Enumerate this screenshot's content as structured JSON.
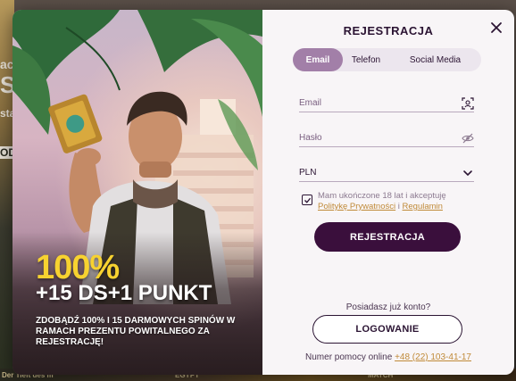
{
  "background": {
    "left_text_1": "ac",
    "left_text_2": "S",
    "left_text_3": "sta",
    "left_text_4": "OD",
    "bottom_text_1": "Der Tieft des m",
    "bottom_text_2": "EGYPT",
    "bottom_text_3": "MATCH"
  },
  "promo": {
    "percent": "100%",
    "bonus": "+15 DS+1 PUNKT",
    "description": "ZDOBĄDŹ 100% I 15 DARMOWYCH SPINÓW W RAMACH PREZENTU POWITALNEGO ZA REJESTRACJĘ!"
  },
  "form": {
    "title": "REJESTRACJA",
    "tabs": [
      {
        "label": "Email",
        "active": true
      },
      {
        "label": "Telefon",
        "active": false
      },
      {
        "label": "Social Media",
        "active": false
      }
    ],
    "email_placeholder": "Email",
    "password_placeholder": "Hasło",
    "currency": "PLN",
    "agree_text": "Mam ukończone 18 lat i akceptuję",
    "privacy_link": "Politykę Prywatności",
    "agree_and": "i",
    "terms_link": "Regulamin",
    "register_button": "REJESTRACJA",
    "have_account": "Posiadasz już konto?",
    "login_button": "LOGOWANIE",
    "helpline_label": "Numer pomocy online",
    "helpline_number": "+48 (22) 103-41-17"
  },
  "icons": {
    "close": "close-icon",
    "email_field": "face-scan-icon",
    "password_field": "eye-slash-icon",
    "currency": "chevron-down-icon",
    "checkbox": "check-icon"
  },
  "colors": {
    "brand_dark": "#3a0f3c",
    "tab_active": "#a27fa8",
    "link": "#c08a38",
    "promo_yellow": "#f7d230",
    "panel_bg": "#f8f5f7"
  }
}
